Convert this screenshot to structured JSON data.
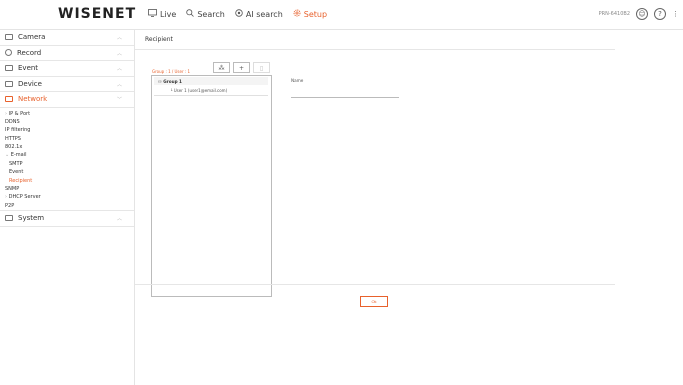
{
  "header": {
    "logo": "WISENET",
    "nav": [
      {
        "label": "Live",
        "icon": "monitor-icon"
      },
      {
        "label": "Search",
        "icon": "search-icon"
      },
      {
        "label": "AI search",
        "icon": "ai-search-icon"
      },
      {
        "label": "Setup",
        "icon": "gear-icon"
      }
    ],
    "model": "PRN-6410B2",
    "accent": "#e8612c"
  },
  "sidebar": {
    "sections": [
      {
        "label": "Camera",
        "icon": "camera-icon"
      },
      {
        "label": "Record",
        "icon": "record-icon"
      },
      {
        "label": "Event",
        "icon": "event-icon"
      },
      {
        "label": "Device",
        "icon": "device-icon"
      },
      {
        "label": "Network",
        "icon": "network-icon"
      }
    ],
    "network_items": [
      "IP & Port",
      "DDNS",
      "IP filtering",
      "HTTPS",
      "802.1x",
      "E-mail",
      "SMTP",
      "Event",
      "Recipient",
      "SNMP",
      "DHCP Server",
      "P2P"
    ],
    "system": {
      "label": "System",
      "icon": "system-icon"
    }
  },
  "main": {
    "title": "Recipient",
    "group_info": "Group : 1 / User : 1",
    "tree": {
      "group": "Group 1",
      "user": "User 1 (user1@email.com)"
    },
    "name_label": "Name",
    "name_value": "",
    "ok_label": "Ok"
  }
}
